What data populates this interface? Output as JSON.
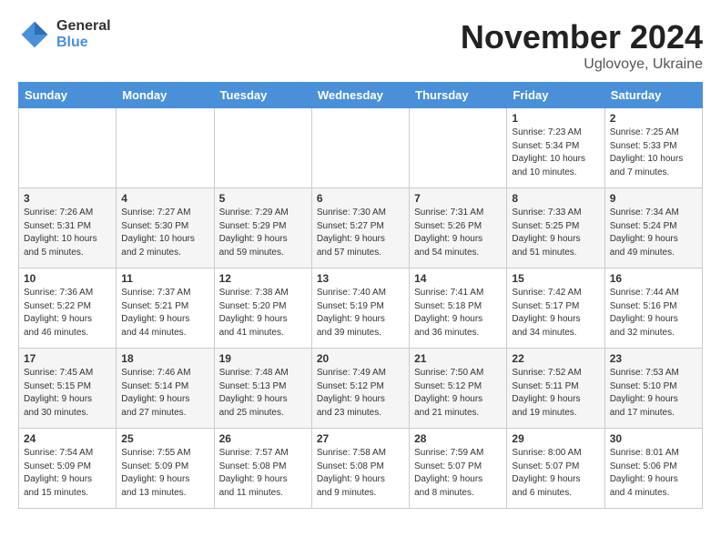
{
  "logo": {
    "general": "General",
    "blue": "Blue"
  },
  "title": "November 2024",
  "location": "Uglovoye, Ukraine",
  "weekdays": [
    "Sunday",
    "Monday",
    "Tuesday",
    "Wednesday",
    "Thursday",
    "Friday",
    "Saturday"
  ],
  "weeks": [
    [
      {
        "day": "",
        "info": ""
      },
      {
        "day": "",
        "info": ""
      },
      {
        "day": "",
        "info": ""
      },
      {
        "day": "",
        "info": ""
      },
      {
        "day": "",
        "info": ""
      },
      {
        "day": "1",
        "info": "Sunrise: 7:23 AM\nSunset: 5:34 PM\nDaylight: 10 hours\nand 10 minutes."
      },
      {
        "day": "2",
        "info": "Sunrise: 7:25 AM\nSunset: 5:33 PM\nDaylight: 10 hours\nand 7 minutes."
      }
    ],
    [
      {
        "day": "3",
        "info": "Sunrise: 7:26 AM\nSunset: 5:31 PM\nDaylight: 10 hours\nand 5 minutes."
      },
      {
        "day": "4",
        "info": "Sunrise: 7:27 AM\nSunset: 5:30 PM\nDaylight: 10 hours\nand 2 minutes."
      },
      {
        "day": "5",
        "info": "Sunrise: 7:29 AM\nSunset: 5:29 PM\nDaylight: 9 hours\nand 59 minutes."
      },
      {
        "day": "6",
        "info": "Sunrise: 7:30 AM\nSunset: 5:27 PM\nDaylight: 9 hours\nand 57 minutes."
      },
      {
        "day": "7",
        "info": "Sunrise: 7:31 AM\nSunset: 5:26 PM\nDaylight: 9 hours\nand 54 minutes."
      },
      {
        "day": "8",
        "info": "Sunrise: 7:33 AM\nSunset: 5:25 PM\nDaylight: 9 hours\nand 51 minutes."
      },
      {
        "day": "9",
        "info": "Sunrise: 7:34 AM\nSunset: 5:24 PM\nDaylight: 9 hours\nand 49 minutes."
      }
    ],
    [
      {
        "day": "10",
        "info": "Sunrise: 7:36 AM\nSunset: 5:22 PM\nDaylight: 9 hours\nand 46 minutes."
      },
      {
        "day": "11",
        "info": "Sunrise: 7:37 AM\nSunset: 5:21 PM\nDaylight: 9 hours\nand 44 minutes."
      },
      {
        "day": "12",
        "info": "Sunrise: 7:38 AM\nSunset: 5:20 PM\nDaylight: 9 hours\nand 41 minutes."
      },
      {
        "day": "13",
        "info": "Sunrise: 7:40 AM\nSunset: 5:19 PM\nDaylight: 9 hours\nand 39 minutes."
      },
      {
        "day": "14",
        "info": "Sunrise: 7:41 AM\nSunset: 5:18 PM\nDaylight: 9 hours\nand 36 minutes."
      },
      {
        "day": "15",
        "info": "Sunrise: 7:42 AM\nSunset: 5:17 PM\nDaylight: 9 hours\nand 34 minutes."
      },
      {
        "day": "16",
        "info": "Sunrise: 7:44 AM\nSunset: 5:16 PM\nDaylight: 9 hours\nand 32 minutes."
      }
    ],
    [
      {
        "day": "17",
        "info": "Sunrise: 7:45 AM\nSunset: 5:15 PM\nDaylight: 9 hours\nand 30 minutes."
      },
      {
        "day": "18",
        "info": "Sunrise: 7:46 AM\nSunset: 5:14 PM\nDaylight: 9 hours\nand 27 minutes."
      },
      {
        "day": "19",
        "info": "Sunrise: 7:48 AM\nSunset: 5:13 PM\nDaylight: 9 hours\nand 25 minutes."
      },
      {
        "day": "20",
        "info": "Sunrise: 7:49 AM\nSunset: 5:12 PM\nDaylight: 9 hours\nand 23 minutes."
      },
      {
        "day": "21",
        "info": "Sunrise: 7:50 AM\nSunset: 5:12 PM\nDaylight: 9 hours\nand 21 minutes."
      },
      {
        "day": "22",
        "info": "Sunrise: 7:52 AM\nSunset: 5:11 PM\nDaylight: 9 hours\nand 19 minutes."
      },
      {
        "day": "23",
        "info": "Sunrise: 7:53 AM\nSunset: 5:10 PM\nDaylight: 9 hours\nand 17 minutes."
      }
    ],
    [
      {
        "day": "24",
        "info": "Sunrise: 7:54 AM\nSunset: 5:09 PM\nDaylight: 9 hours\nand 15 minutes."
      },
      {
        "day": "25",
        "info": "Sunrise: 7:55 AM\nSunset: 5:09 PM\nDaylight: 9 hours\nand 13 minutes."
      },
      {
        "day": "26",
        "info": "Sunrise: 7:57 AM\nSunset: 5:08 PM\nDaylight: 9 hours\nand 11 minutes."
      },
      {
        "day": "27",
        "info": "Sunrise: 7:58 AM\nSunset: 5:08 PM\nDaylight: 9 hours\nand 9 minutes."
      },
      {
        "day": "28",
        "info": "Sunrise: 7:59 AM\nSunset: 5:07 PM\nDaylight: 9 hours\nand 8 minutes."
      },
      {
        "day": "29",
        "info": "Sunrise: 8:00 AM\nSunset: 5:07 PM\nDaylight: 9 hours\nand 6 minutes."
      },
      {
        "day": "30",
        "info": "Sunrise: 8:01 AM\nSunset: 5:06 PM\nDaylight: 9 hours\nand 4 minutes."
      }
    ]
  ]
}
